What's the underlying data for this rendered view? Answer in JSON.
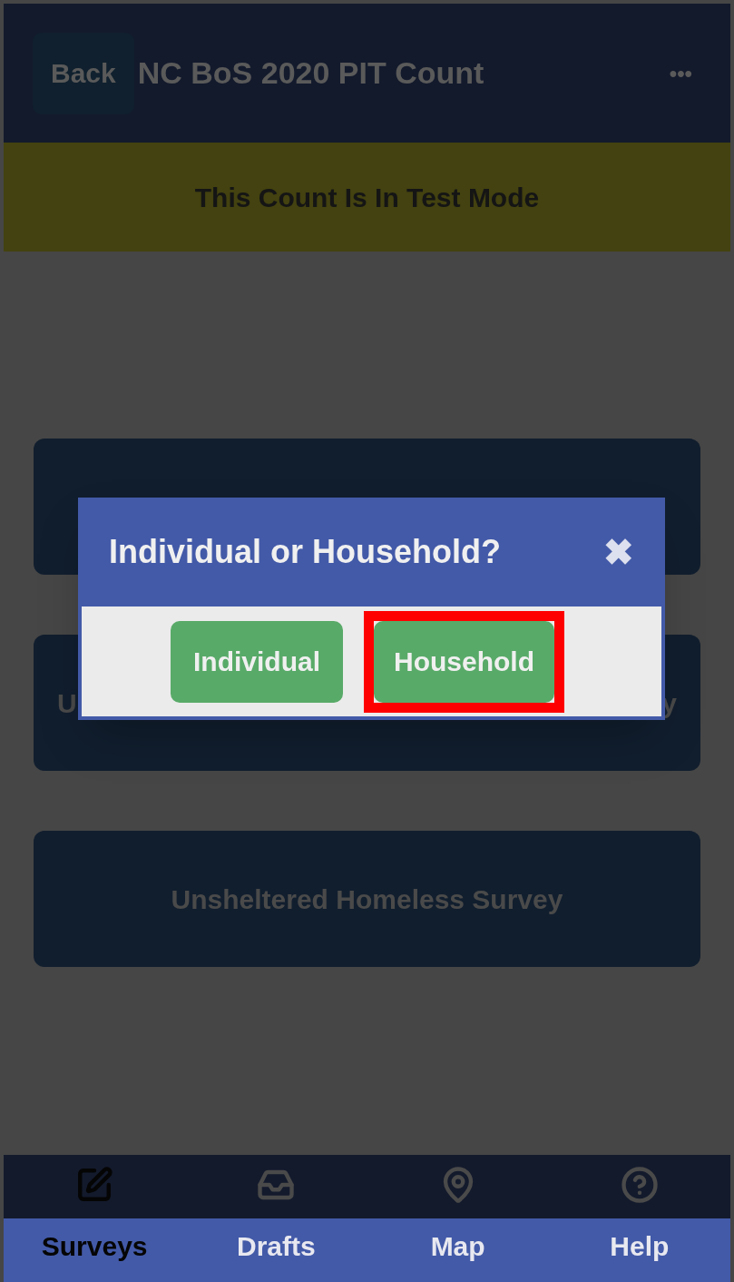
{
  "header": {
    "back": "Back",
    "title": "NC BoS 2020 PIT Count",
    "menu": "•••"
  },
  "banner": "This Count Is In Test Mode",
  "cards": [
    {
      "kind": "blank"
    },
    {
      "kind": "split",
      "left": "U",
      "right": "y"
    },
    {
      "kind": "centered",
      "left": "Unsheltered Homeless Survey"
    }
  ],
  "dialog": {
    "title": "Individual or Household?",
    "close": "✖",
    "buttons": [
      {
        "label": "Individual",
        "highlighted": false
      },
      {
        "label": "Household",
        "highlighted": true
      }
    ]
  },
  "nav": [
    {
      "label": "Surveys",
      "selected": true
    },
    {
      "label": "Drafts",
      "selected": false
    },
    {
      "label": "Map",
      "selected": false
    },
    {
      "label": "Help",
      "selected": false
    }
  ]
}
